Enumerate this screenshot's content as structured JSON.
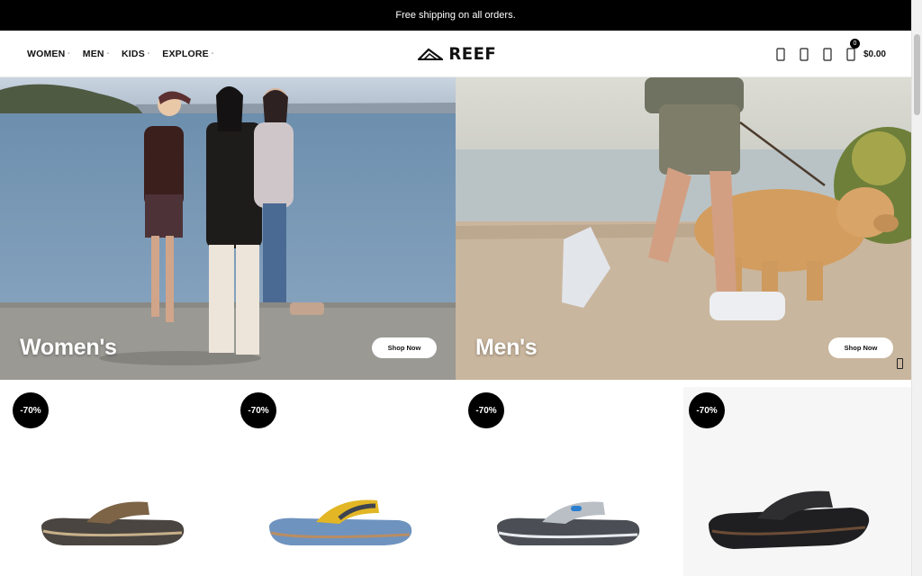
{
  "announcement": "Free shipping on all orders.",
  "nav": [
    {
      "label": "WOMEN"
    },
    {
      "label": "MEN"
    },
    {
      "label": "KIDS"
    },
    {
      "label": "EXPLORE"
    }
  ],
  "brand": {
    "name": "REEF"
  },
  "header_icons": [
    "search-icon",
    "user-icon",
    "wishlist-icon"
  ],
  "cart": {
    "count": "0",
    "total": "$0.00"
  },
  "heroes": [
    {
      "title": "Women's",
      "button": "Shop Now"
    },
    {
      "title": "Men's",
      "button": "Shop Now"
    }
  ],
  "products": [
    {
      "discount": "-70%",
      "strap_color": "#7d6446",
      "sole_color": "#4a4540"
    },
    {
      "discount": "-70%",
      "strap_color": "#e2b624",
      "sole_color": "#6f93bf"
    },
    {
      "discount": "-70%",
      "strap_color": "#b9bfc5",
      "sole_color": "#4b4f55"
    },
    {
      "discount": "-70%",
      "strap_color": "#2e2e30",
      "sole_color": "#1f1f21"
    }
  ],
  "colors": {
    "accent": "#000000",
    "background": "#ffffff"
  }
}
